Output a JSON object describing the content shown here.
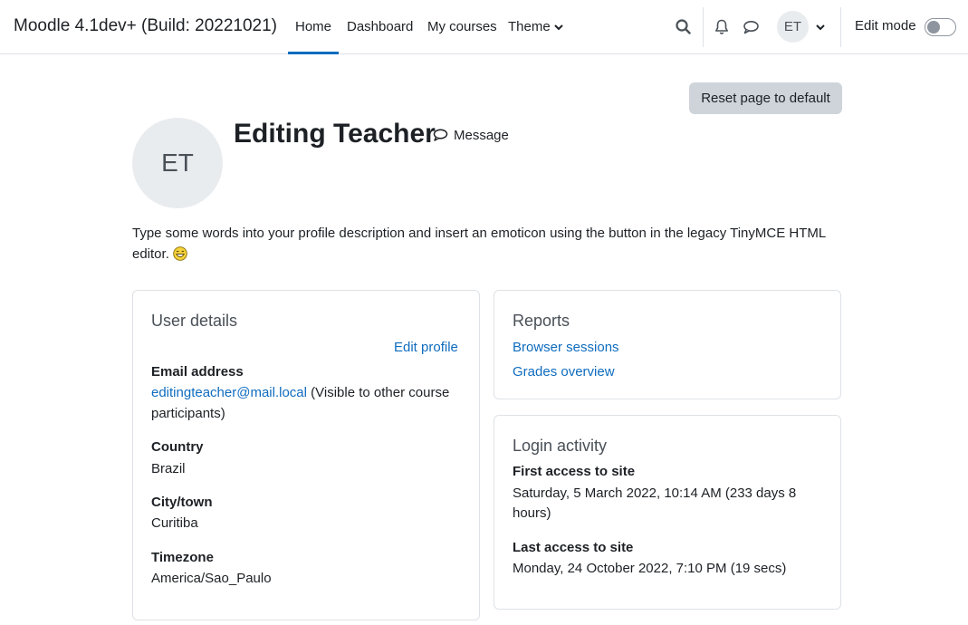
{
  "navbar": {
    "site_name": "Moodle 4.1dev+ (Build: 20221021)",
    "items": [
      {
        "label": "Home",
        "active": true
      },
      {
        "label": "Dashboard",
        "active": false
      },
      {
        "label": "My courses",
        "active": false
      },
      {
        "label": "Theme",
        "active": false
      }
    ],
    "user_initials": "ET",
    "edit_mode_label": "Edit mode",
    "edit_mode_on": false
  },
  "page": {
    "reset_button_label": "Reset page to default",
    "profile_initials": "ET",
    "profile_name": "Editing Teacher",
    "message_label": "Message",
    "description": "Type some words into your profile description and insert an emoticon using the button in the legacy TinyMCE HTML editor."
  },
  "user_details": {
    "title": "User details",
    "edit_profile_label": "Edit profile",
    "email_label": "Email address",
    "email_value": "editingteacher@mail.local",
    "email_visibility": "(Visible to other course",
    "email_visibility_2": "participants)",
    "country_label": "Country",
    "country_value": "Brazil",
    "city_label": "City/town",
    "city_value": "Curitiba",
    "timezone_label": "Timezone",
    "timezone_value": "America/Sao_Paulo"
  },
  "reports": {
    "title": "Reports",
    "links": [
      "Browser sessions",
      "Grades overview"
    ]
  },
  "login_activity": {
    "title": "Login activity",
    "first_access_label": "First access to site",
    "first_access_value": "Saturday, 5 March 2022, 10:14 AM  (233 days 8",
    "first_access_value_2": "hours)",
    "last_access_label": "Last access to site",
    "last_access_value": "Monday, 24 October 2022, 7:10 PM  (19 secs)"
  },
  "colors": {
    "link": "#0f6cbf",
    "text": "#1d2125",
    "muted": "#495057",
    "border": "#dee2e6",
    "avatar_bg": "#e9ecef",
    "button_bg": "#ced4da"
  }
}
